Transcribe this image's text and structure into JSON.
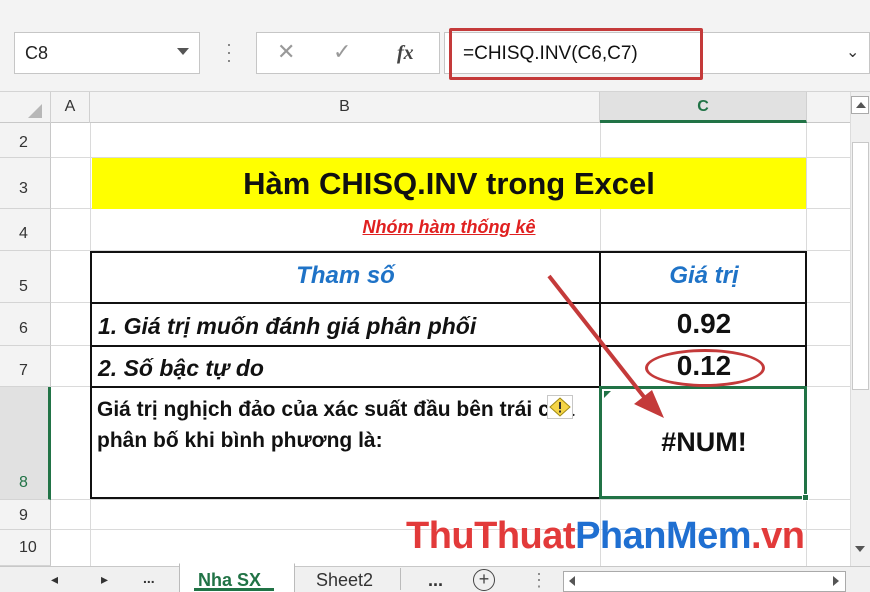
{
  "formula_bar": {
    "name_box": "C8",
    "cancel_icon": "✕",
    "enter_icon": "✓",
    "fx_label": "fx",
    "formula": "=CHISQ.INV(C6,C7)"
  },
  "columns": [
    "A",
    "B",
    "C"
  ],
  "rows": [
    "2",
    "3",
    "4",
    "5",
    "6",
    "7",
    "8",
    "9",
    "10"
  ],
  "sheet": {
    "title": "Hàm CHISQ.INV trong Excel",
    "subtitle": "Nhóm hàm thống kê",
    "table": {
      "header_param": "Tham số",
      "header_value": "Giá trị",
      "row1_label": "1. Giá trị muốn đánh giá phân phối",
      "row1_value": "0.92",
      "row2_label": "2. Số bậc tự do",
      "row2_value": "0.12",
      "row3_label": "Giá trị nghịch đảo của xác suất đầu bên trái của phân bố khi bình phương là:",
      "row3_value": "#NUM!"
    }
  },
  "tabs": {
    "nav_ellipsis": "...",
    "active": "Nha SX",
    "other": "Sheet2",
    "more": "...",
    "add": "+"
  },
  "watermark": {
    "part1": "ThuThuat",
    "part2": "PhanMem",
    "part3": ".vn"
  },
  "colors": {
    "excel_green": "#217346",
    "title_fill": "#ffff00",
    "header_blue": "#1f73c7",
    "highlight_red": "#c43a3a"
  }
}
